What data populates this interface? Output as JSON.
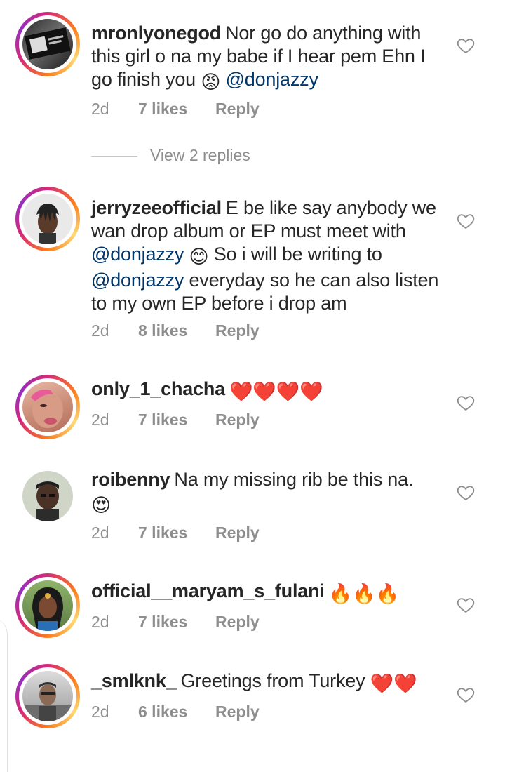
{
  "comments": [
    {
      "username": "mronlyonegod",
      "text_parts": [
        "Nor go do anything with this girl o na my babe if I hear pem Ehn I go finish you "
      ],
      "emoji": "😡",
      "mention": "@donjazzy",
      "time": "2d",
      "likes": "7 likes",
      "reply": "Reply"
    },
    {
      "username": "jerryzeeofficial",
      "text_a": "E be like say anybody we wan drop album or EP must meet with ",
      "mention_a": "@donjazzy",
      "emoji": "😊",
      "text_b": " So i will be writing to ",
      "mention_b": "@donjazzy",
      "text_c": " everyday so he can also listen to my own EP before i drop am",
      "time": "2d",
      "likes": "8 likes",
      "reply": "Reply"
    },
    {
      "username": "only_1_chacha",
      "emoji": "❤️❤️❤️❤️",
      "time": "2d",
      "likes": "7 likes",
      "reply": "Reply"
    },
    {
      "username": "roibenny",
      "text": "Na my missing rib be this na.",
      "emoji": "😍",
      "time": "2d",
      "likes": "7 likes",
      "reply": "Reply"
    },
    {
      "username": "official__maryam_s_fulani",
      "emoji": "🔥🔥🔥",
      "time": "2d",
      "likes": "7 likes",
      "reply": "Reply"
    },
    {
      "username": "_smlknk_",
      "text": "Greetings from Turkey",
      "emoji": "❤️❤️",
      "time": "2d",
      "likes": "6 likes",
      "reply": "Reply"
    }
  ],
  "view_replies": "View 2 replies",
  "colors": {
    "text": "#262626",
    "meta": "#8e8e8e",
    "mention": "#00376b",
    "ring_start": "#d62976",
    "ring_end": "#fa7e1e"
  },
  "icons": {
    "like": "heart-outline-icon"
  }
}
